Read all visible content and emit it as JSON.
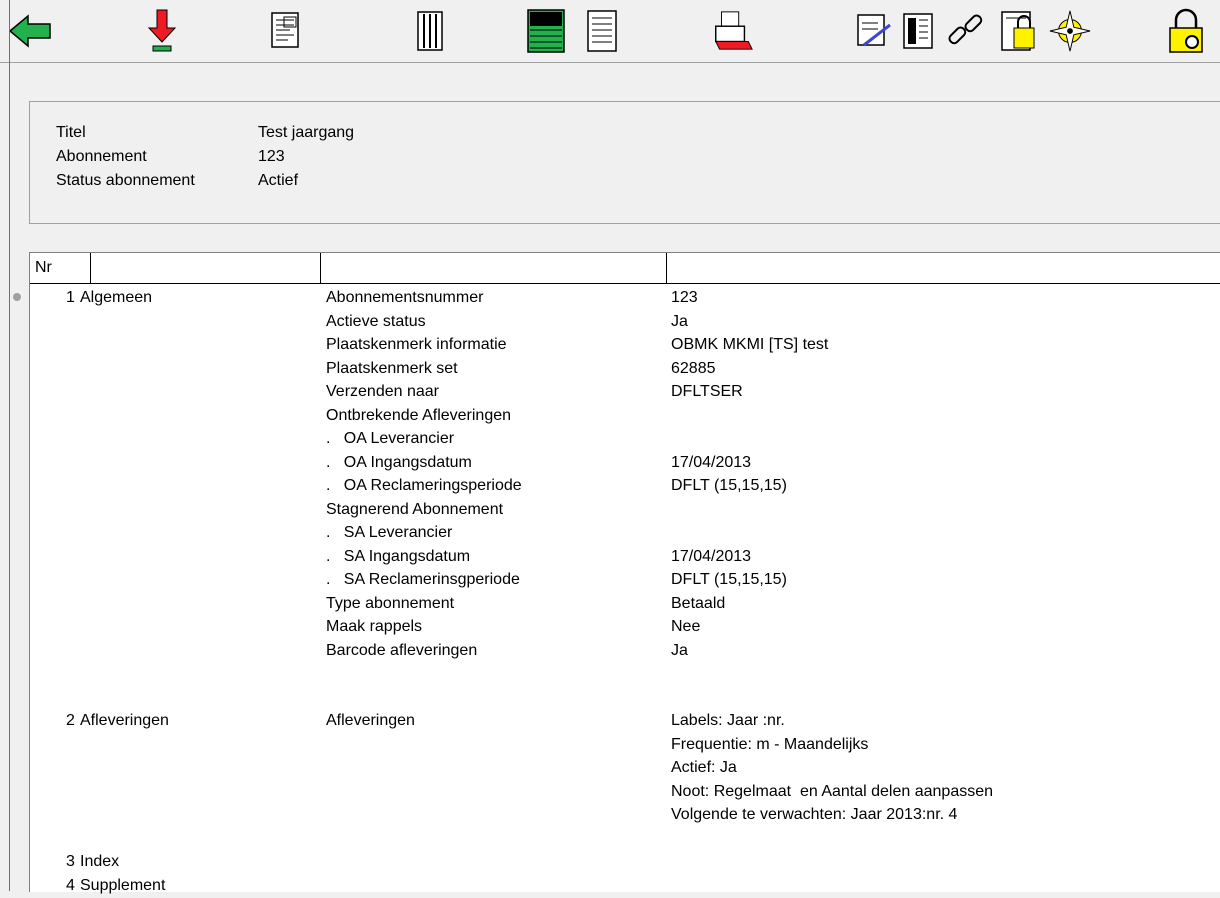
{
  "toolbar": {
    "icons": [
      "back-arrow-icon",
      "download-arrow-icon",
      "document-list-icon",
      "columns-icon",
      "green-table-icon",
      "text-document-icon",
      "printer-icon",
      "edit-document-icon",
      "report-icon",
      "link-icon",
      "lock-document-icon",
      "compass-icon",
      "lock-settings-icon"
    ]
  },
  "header": {
    "title_label": "Titel",
    "title_value": "Test jaargang",
    "subscription_label": "Abonnement",
    "subscription_value": "123",
    "status_label": "Status abonnement",
    "status_value": "Actief"
  },
  "grid": {
    "col_nr": "Nr",
    "sections": [
      {
        "nr": "1",
        "name": "Algemeen"
      },
      {
        "nr": "2",
        "name": "Afleveringen"
      },
      {
        "nr": "3",
        "name": "Index"
      },
      {
        "nr": "4",
        "name": "Supplement"
      }
    ],
    "rows": [
      {
        "field": "Abonnementsnummer",
        "value": "123"
      },
      {
        "field": "Actieve status",
        "value": "Ja"
      },
      {
        "field": "Plaatskenmerk informatie",
        "value": "OBMK MKMI [TS] test"
      },
      {
        "field": "Plaatskenmerk set",
        "value": "62885"
      },
      {
        "field": "Verzenden naar",
        "value": "DFLTSER"
      },
      {
        "field": "Ontbrekende Afleveringen",
        "value": ""
      },
      {
        "field": ".   OA Leverancier",
        "value": ""
      },
      {
        "field": ".   OA Ingangsdatum",
        "value": "17/04/2013"
      },
      {
        "field": ".   OA Reclameringsperiode",
        "value": "DFLT (15,15,15)"
      },
      {
        "field": "Stagnerend Abonnement",
        "value": ""
      },
      {
        "field": ".   SA Leverancier",
        "value": ""
      },
      {
        "field": ".   SA Ingangsdatum",
        "value": "17/04/2013"
      },
      {
        "field": ".   SA Reclamerinsgperiode",
        "value": "DFLT (15,15,15)"
      },
      {
        "field": "Type abonnement",
        "value": "Betaald"
      },
      {
        "field": "Maak rappels",
        "value": "Nee"
      },
      {
        "field": "Barcode afleveringen",
        "value": "Ja"
      },
      {
        "field": "Afleveringen",
        "value": "Labels: Jaar :nr."
      },
      {
        "field": "",
        "value": "Frequentie: m - Maandelijks"
      },
      {
        "field": "",
        "value": "Actief: Ja"
      },
      {
        "field": "",
        "value": "Noot: Regelmaat  en Aantal delen aanpassen"
      },
      {
        "field": "",
        "value": "Volgende te verwachten: Jaar 2013:nr. 4"
      }
    ]
  }
}
